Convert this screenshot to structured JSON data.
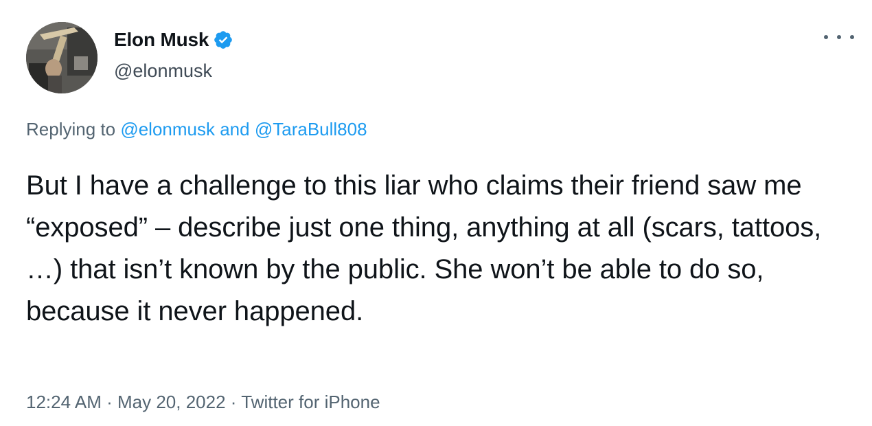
{
  "author": {
    "display_name": "Elon Musk",
    "handle": "@elonmusk",
    "verified": true,
    "avatar_icon": "profile-photo",
    "verified_color": "#1d9bf0"
  },
  "reply": {
    "prefix": "Replying to",
    "mention1": "@elonmusk",
    "joiner": "and",
    "mention2": "@TaraBull808"
  },
  "tweet": {
    "text": "But I have a challenge to this liar who claims their friend saw me “exposed” – describe just one thing, anything at all (scars, tattoos, …) that isn’t known by the public. She won’t be able to do so, because it never happened."
  },
  "meta": {
    "time": "12:24 AM",
    "sep1": "·",
    "date": "May 20, 2022",
    "sep2": "·",
    "source": "Twitter for iPhone"
  },
  "more_menu_icon": "more-horizontal-icon",
  "colors": {
    "text_primary": "#0f1419",
    "text_secondary": "#536471",
    "link": "#1d9bf0"
  }
}
